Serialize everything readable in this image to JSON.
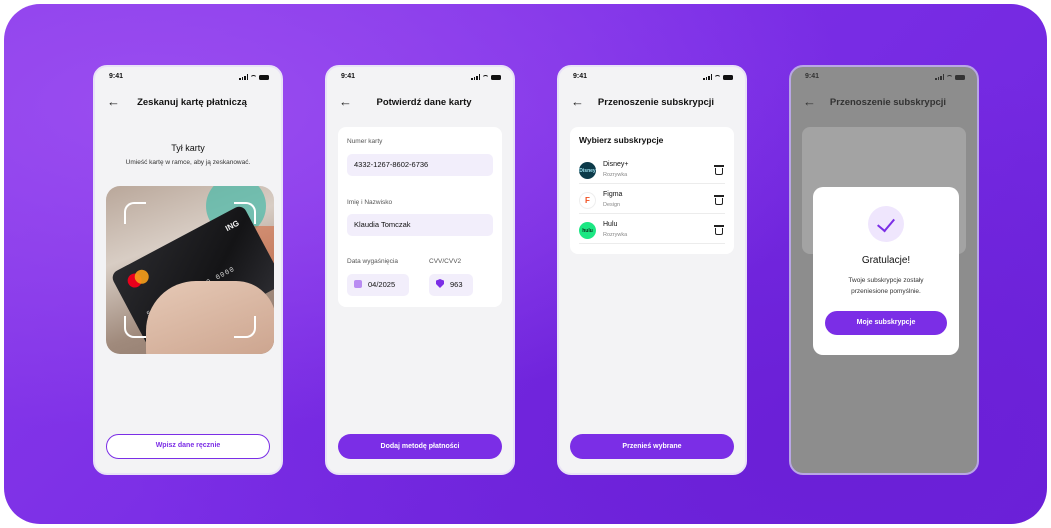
{
  "status_time": "9:41",
  "screens": [
    {
      "title": "Zeskanuj kartę płatniczą",
      "subtitle": "Tył karty",
      "description": "Umieść kartę w ramce, aby ją zeskanować.",
      "button": "Wpisz dane ręcznie"
    },
    {
      "title": "Potwierdź dane karty",
      "fields": {
        "card_number_label": "Numer karty",
        "card_number_value": "4332-1267-8602-6736",
        "name_label": "Imię i Nazwisko",
        "name_value": "Klaudia Tomczak",
        "expiry_label": "Data wygaśnięcia",
        "expiry_value": "04/2025",
        "cvv_label": "CVV/CVV2",
        "cvv_value": "963"
      },
      "button": "Dodaj metodę płatności"
    },
    {
      "title": "Przenoszenie subskrypcji",
      "list_title": "Wybierz subskrypcje",
      "subscriptions": [
        {
          "name": "Disney+",
          "category": "Rozrywka",
          "logo_text": "Disney",
          "logo_color": "#0d3b4a",
          "logo_text_color": "#9fe0ee"
        },
        {
          "name": "Figma",
          "category": "Design",
          "logo_text": "F",
          "logo_color": "#ffffff",
          "logo_text_color": "#f24e1e"
        },
        {
          "name": "Hulu",
          "category": "Rozrywka",
          "logo_text": "hulu",
          "logo_color": "#1ce783",
          "logo_text_color": "#0b2d1c"
        }
      ],
      "button": "Przenieś wybrane"
    },
    {
      "title": "Przenoszenie subskrypcji",
      "modal_title": "Gratulacje!",
      "modal_description": "Twoje subskrypcje zostały przeniesione pomyślnie.",
      "modal_button": "Moje subskrypcje"
    }
  ],
  "colors": {
    "accent": "#7b2ee6",
    "background": "#7b2ee6",
    "phone_bg": "#f3f3f5",
    "input_bg": "#f2eefb"
  }
}
